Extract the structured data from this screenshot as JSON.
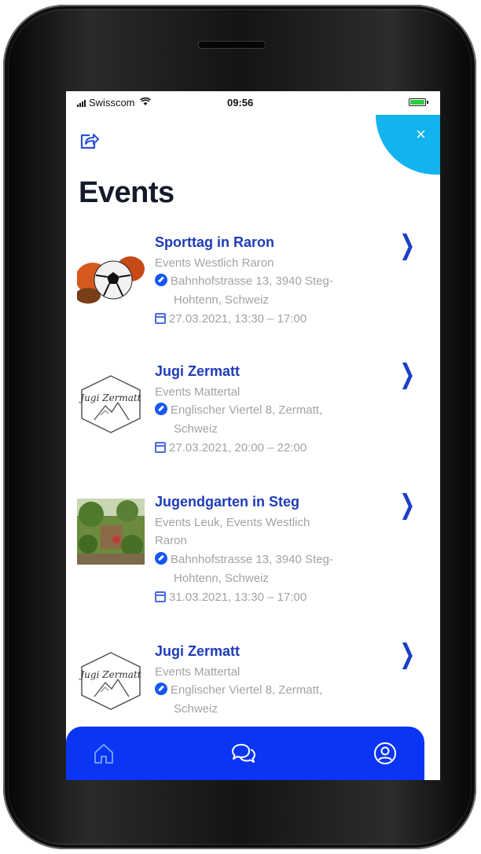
{
  "status_bar": {
    "carrier": "Swisscom",
    "time": "09:56"
  },
  "header": {
    "title": "Events",
    "share_icon": "share-icon",
    "close_icon": "close-icon",
    "close_glyph": "×"
  },
  "colors": {
    "accent_blue": "#1e3bb8",
    "tabbar_blue": "#0b35f5",
    "close_cyan": "#12b3ee",
    "muted_gray": "#a3a3a3"
  },
  "events": [
    {
      "title": "Sporttag in Raron",
      "categories": "Events Westlich Raron",
      "address_line1": "Bahnhofstrasse 13, 3940 Steg-",
      "address_line2": "Hohtenn, Schweiz",
      "datetime": "27.03.2021, 13:30 – 17:00",
      "image": "sports-balls-image"
    },
    {
      "title": "Jugi Zermatt",
      "categories": "Events Mattertal",
      "address_line1": "Englischer Viertel 8, Zermatt,",
      "address_line2": "Schweiz",
      "datetime": "27.03.2021, 20:00 – 22:00",
      "image": "jugi-zermatt-logo",
      "logo_text": "Jugi Zermatt"
    },
    {
      "title": "Jugendgarten in Steg",
      "categories_line1": "Events Leuk, Events Westlich",
      "categories_line2": "Raron",
      "address_line1": "Bahnhofstrasse 13, 3940 Steg-",
      "address_line2": "Hohtenn, Schweiz",
      "datetime": "31.03.2021, 13:30 – 17:00",
      "image": "garden-photo"
    },
    {
      "title": "Jugi Zermatt",
      "categories": "Events Mattertal",
      "address_line1": "Englischer Viertel 8, Zermatt,",
      "address_line2": "Schweiz",
      "image": "jugi-zermatt-logo",
      "logo_text": "Jugi Zermatt"
    }
  ],
  "tab_bar": {
    "tabs": [
      "home-icon",
      "chat-icon",
      "profile-icon"
    ]
  }
}
